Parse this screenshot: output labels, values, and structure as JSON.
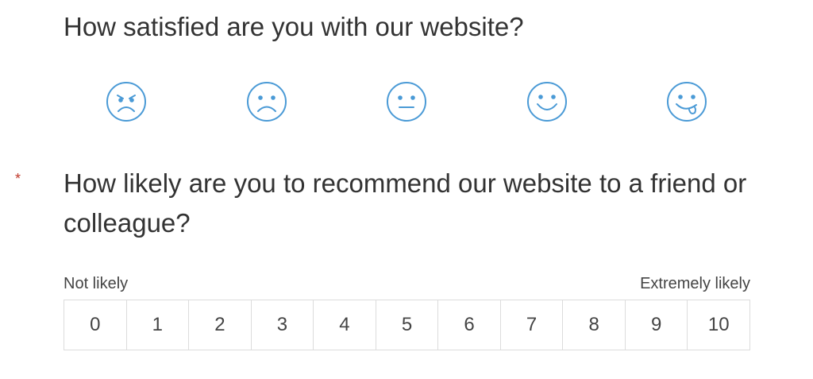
{
  "question1": {
    "title": "How satisfied are you with our website?",
    "accent_color": "#4a9ad6",
    "faces": [
      {
        "icon": "angry-face-icon"
      },
      {
        "icon": "sad-face-icon"
      },
      {
        "icon": "neutral-face-icon"
      },
      {
        "icon": "smile-face-icon"
      },
      {
        "icon": "playful-face-icon"
      }
    ]
  },
  "question2": {
    "required_marker": "*",
    "required_color": "#c0392b",
    "title": "How likely are you to recommend our website to a friend or colleague?",
    "low_label": "Not likely",
    "high_label": "Extremely likely",
    "options": [
      "0",
      "1",
      "2",
      "3",
      "4",
      "5",
      "6",
      "7",
      "8",
      "9",
      "10"
    ]
  }
}
